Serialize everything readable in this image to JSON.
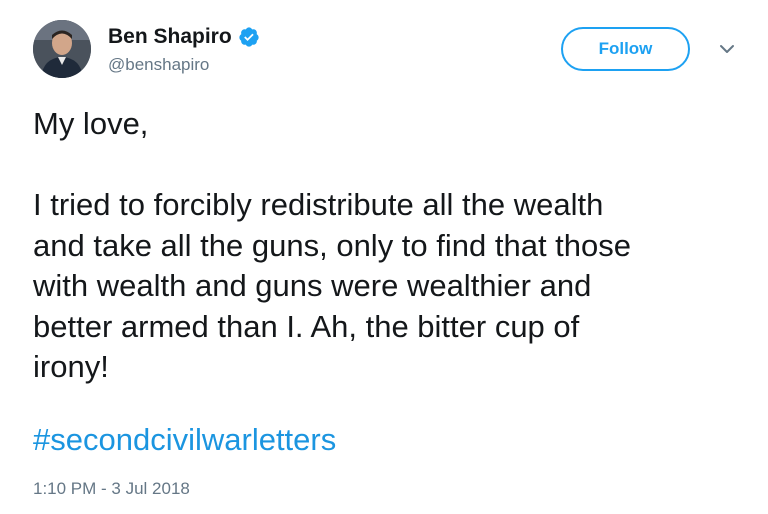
{
  "author": {
    "display_name": "Ben Shapiro",
    "handle": "@benshapiro",
    "verified": true,
    "avatar_icon": "profile-photo"
  },
  "actions": {
    "follow_label": "Follow",
    "menu_icon": "chevron-down-icon"
  },
  "tweet": {
    "text": "My love,\n\nI tried to forcibly redistribute all the wealth\nand take all the guns, only to find that those\nwith wealth and guns were wealthier and\nbetter armed than I. Ah, the bitter cup of\nirony!",
    "hashtag": "#secondcivilwarletters",
    "timestamp": "1:10 PM - 3 Jul 2018"
  },
  "colors": {
    "accent": "#1da1f2",
    "hashtag": "#1b95e0",
    "secondary_text": "#657786",
    "primary_text": "#14171a"
  }
}
